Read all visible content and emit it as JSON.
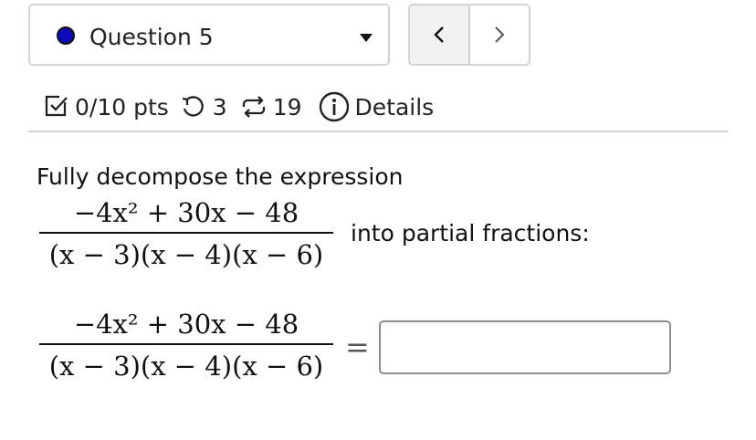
{
  "question_selector": {
    "label": "Question 5",
    "status_color": "#0b0bbd"
  },
  "nav": {
    "prev_icon": "chevron-left-icon",
    "next_icon": "chevron-right-icon"
  },
  "meta": {
    "points": "0/10 pts",
    "retries": "3",
    "submissions": "19",
    "details": "Details"
  },
  "problem": {
    "intro": "Fully decompose the expression",
    "expression": {
      "numerator": "−4x² + 30x − 48",
      "denominator": "(x − 3)(x − 4)(x − 6)"
    },
    "inline_suffix": "into partial fractions:",
    "equals": "=",
    "answer_value": ""
  }
}
